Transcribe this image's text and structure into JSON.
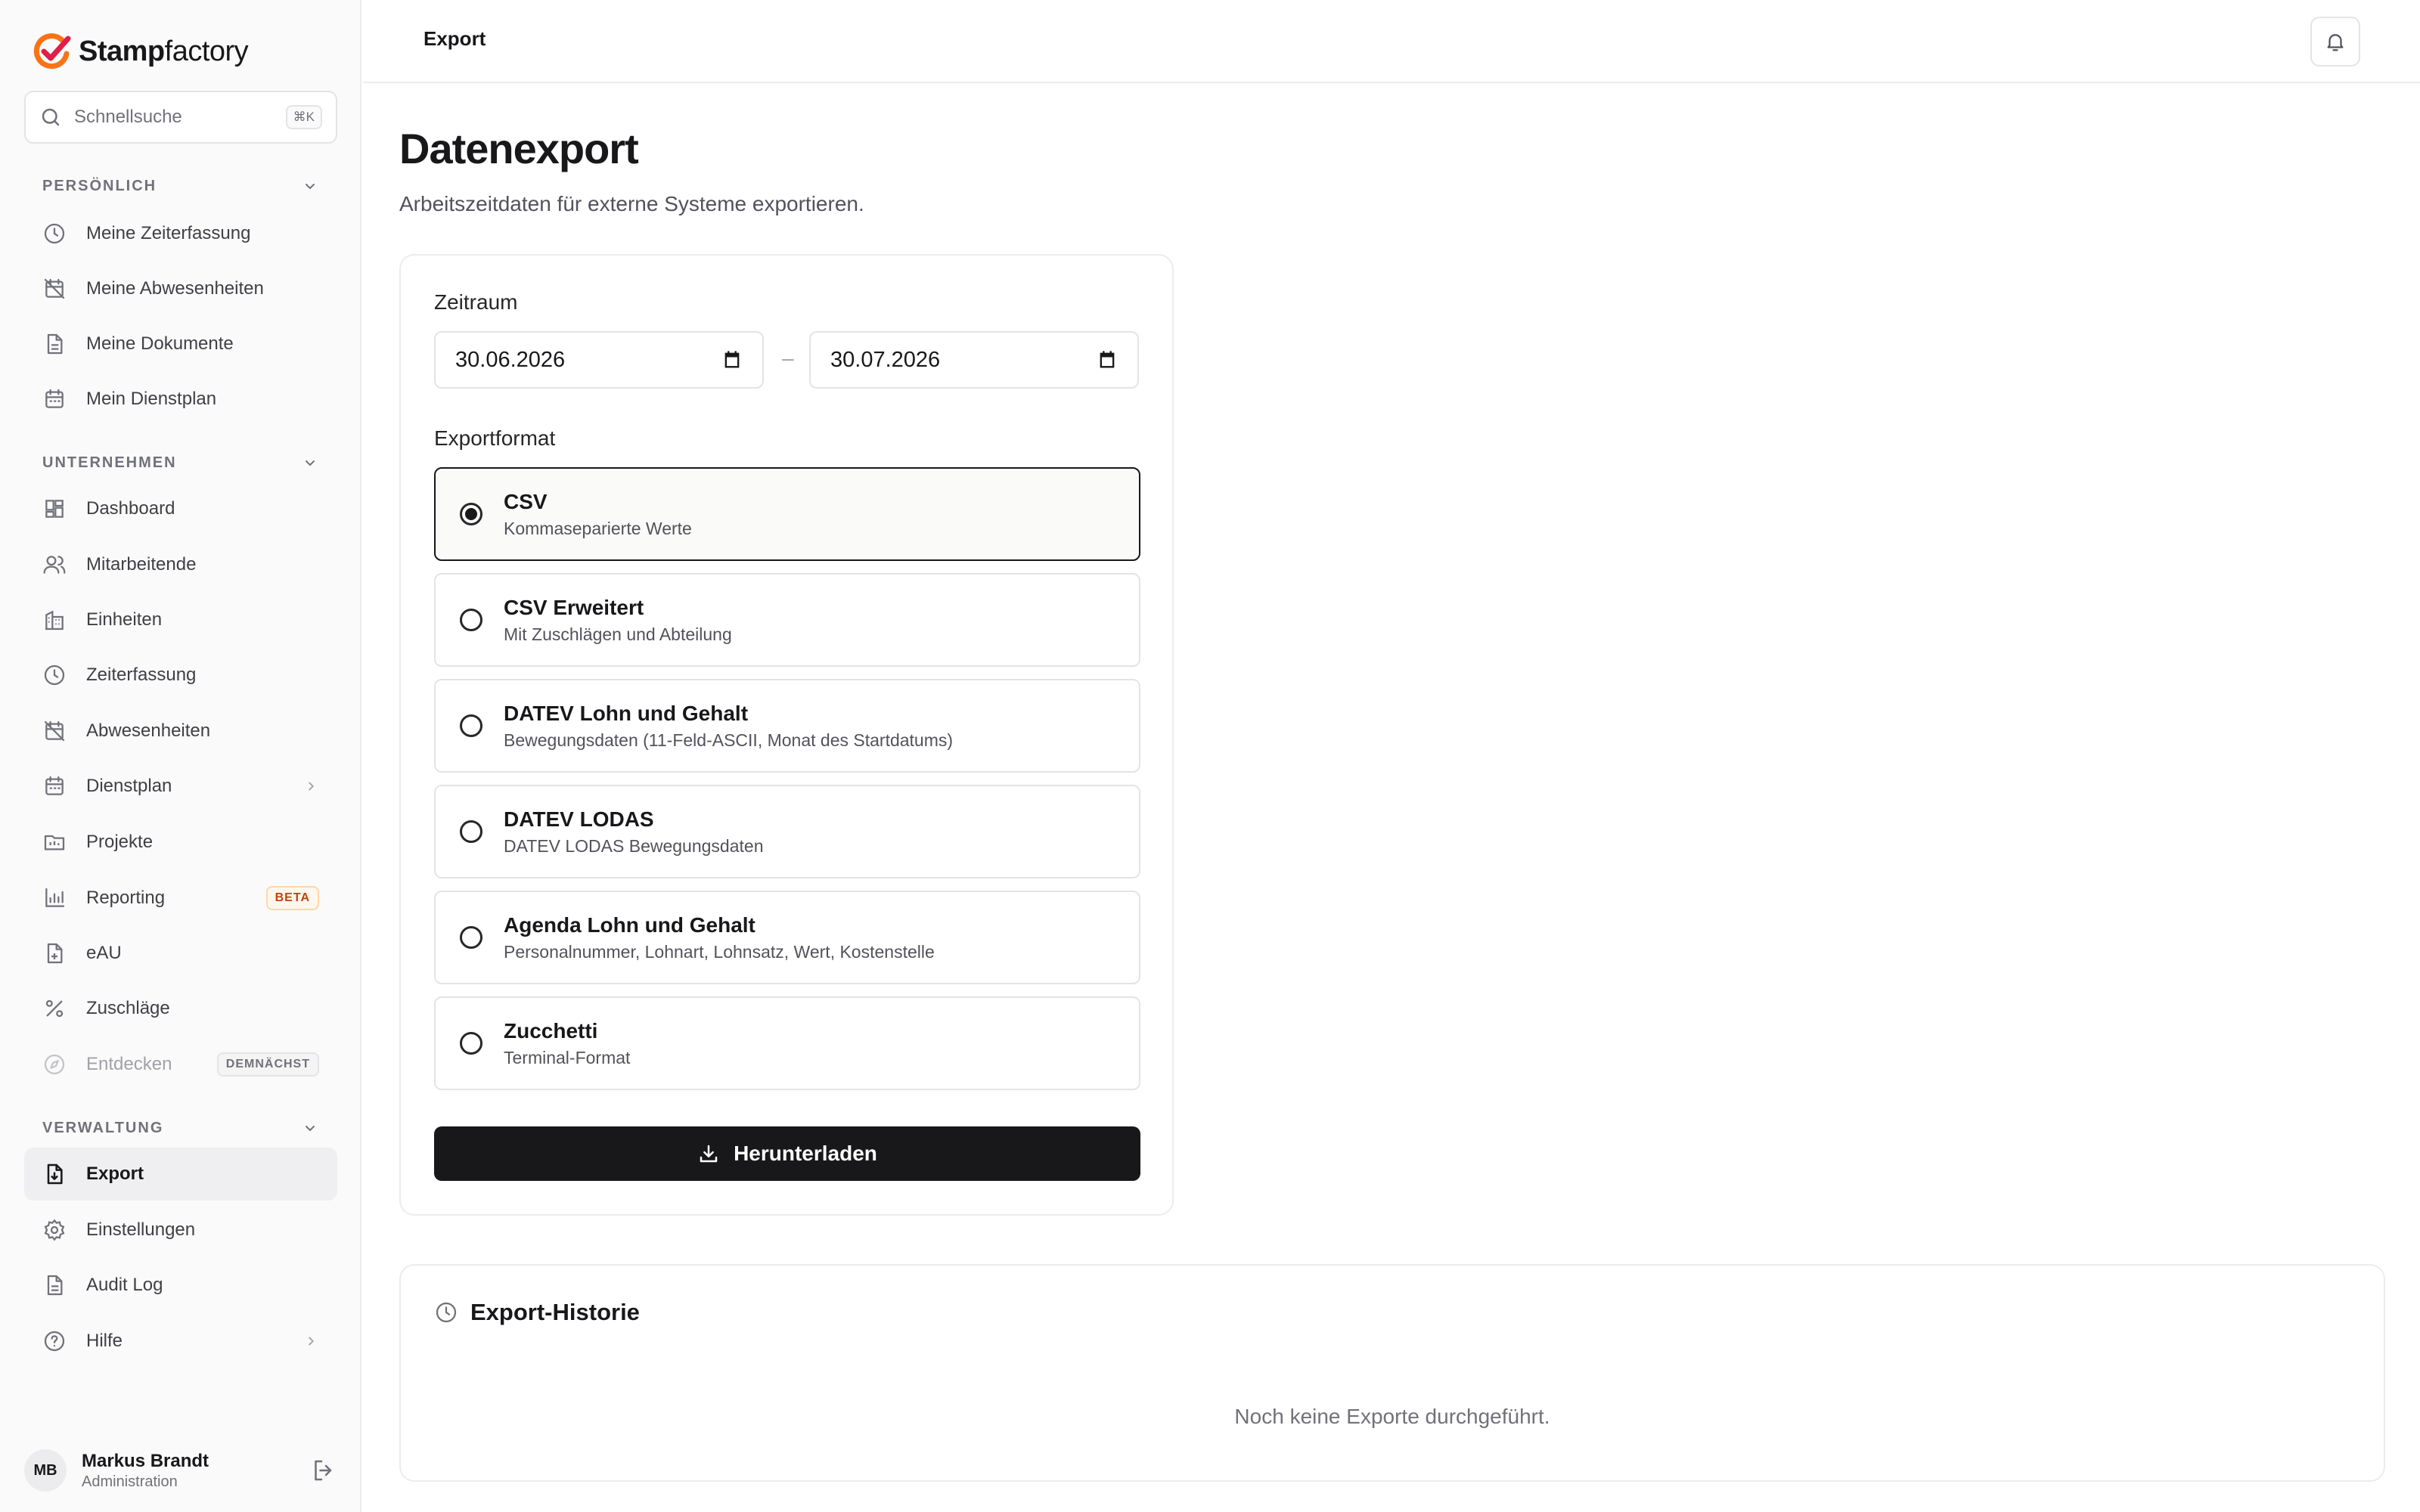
{
  "brand": {
    "name_bold": "Stamp",
    "name_rest": "factory",
    "accent": "#f97316",
    "check_color": "#e11d48"
  },
  "search": {
    "placeholder": "Schnellsuche",
    "shortcut": "⌘K"
  },
  "sidebar": {
    "sections": [
      {
        "title": "PERSÖNLICH"
      },
      {
        "title": "UNTERNEHMEN"
      },
      {
        "title": "VERWALTUNG"
      }
    ],
    "personal": [
      {
        "label": "Meine Zeiterfassung",
        "icon": "clock-icon"
      },
      {
        "label": "Meine Abwesenheiten",
        "icon": "calendar-off-icon"
      },
      {
        "label": "Meine Dokumente",
        "icon": "document-icon"
      },
      {
        "label": "Mein Dienstplan",
        "icon": "calendar-icon"
      }
    ],
    "company": [
      {
        "label": "Dashboard",
        "icon": "dashboard-icon"
      },
      {
        "label": "Mitarbeitende",
        "icon": "users-icon"
      },
      {
        "label": "Einheiten",
        "icon": "building-icon"
      },
      {
        "label": "Zeiterfassung",
        "icon": "clock-icon"
      },
      {
        "label": "Abwesenheiten",
        "icon": "calendar-off-icon"
      },
      {
        "label": "Dienstplan",
        "icon": "calendar-icon"
      },
      {
        "label": "Projekte",
        "icon": "folder-icon"
      },
      {
        "label": "Reporting",
        "icon": "bar-chart-icon",
        "badge": "BETA"
      },
      {
        "label": "eAU",
        "icon": "file-medical-icon"
      },
      {
        "label": "Zuschläge",
        "icon": "percent-icon"
      },
      {
        "label": "Entdecken",
        "icon": "compass-icon",
        "badge": "DEMNÄCHST"
      }
    ],
    "admin": [
      {
        "label": "Export",
        "icon": "file-export-icon",
        "active": true
      },
      {
        "label": "Einstellungen",
        "icon": "gear-icon"
      },
      {
        "label": "Audit Log",
        "icon": "document-icon"
      },
      {
        "label": "Hilfe",
        "icon": "help-icon"
      }
    ]
  },
  "user": {
    "initials": "MB",
    "name": "Markus Brandt",
    "role": "Administration"
  },
  "header": {
    "breadcrumb": "Export"
  },
  "page": {
    "title": "Datenexport",
    "subtitle": "Arbeitszeitdaten für externe Systeme exportieren."
  },
  "export_form": {
    "period_label": "Zeitraum",
    "date_from": "30.06.2026",
    "date_separator": "–",
    "date_to": "30.07.2026",
    "format_label": "Exportformat",
    "formats": [
      {
        "title": "CSV",
        "description": "Kommaseparierte Werte",
        "selected": true
      },
      {
        "title": "CSV Erweitert",
        "description": "Mit Zuschlägen und Abteilung",
        "selected": false
      },
      {
        "title": "DATEV Lohn und Gehalt",
        "description": "Bewegungsdaten (11-Feld-ASCII, Monat des Startdatums)",
        "selected": false
      },
      {
        "title": "DATEV LODAS",
        "description": "DATEV LODAS Bewegungsdaten",
        "selected": false
      },
      {
        "title": "Agenda Lohn und Gehalt",
        "description": "Personalnummer, Lohnart, Lohnsatz, Wert, Kostenstelle",
        "selected": false
      },
      {
        "title": "Zucchetti",
        "description": "Terminal-Format",
        "selected": false
      }
    ],
    "download_label": "Herunterladen"
  },
  "history": {
    "title": "Export-Historie",
    "empty_text": "Noch keine Exporte durchgeführt."
  }
}
